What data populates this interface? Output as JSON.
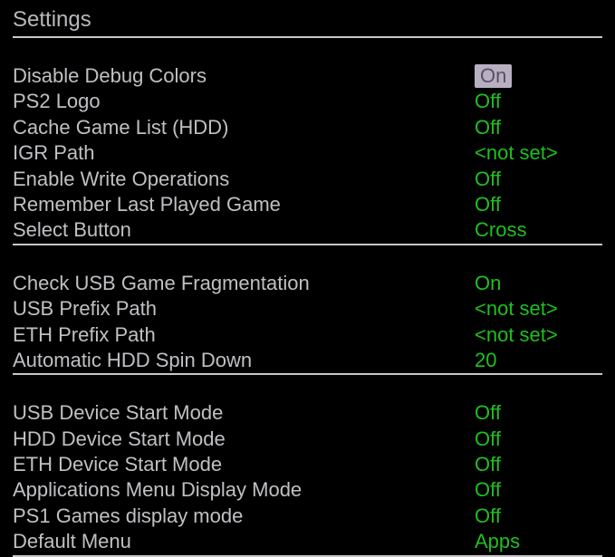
{
  "title": "Settings",
  "sections": [
    {
      "rows": [
        {
          "label": "Disable Debug Colors",
          "value": "On",
          "selected": true
        },
        {
          "label": "PS2 Logo",
          "value": "Off"
        },
        {
          "label": "Cache Game List (HDD)",
          "value": "Off"
        },
        {
          "label": "IGR Path",
          "value": "<not set>"
        },
        {
          "label": "Enable Write Operations",
          "value": "Off"
        },
        {
          "label": "Remember Last Played Game",
          "value": "Off"
        },
        {
          "label": "Select Button",
          "value": "Cross"
        }
      ]
    },
    {
      "rows": [
        {
          "label": "Check USB Game Fragmentation",
          "value": "On"
        },
        {
          "label": "USB Prefix Path",
          "value": "<not set>"
        },
        {
          "label": "ETH Prefix Path",
          "value": "<not set>"
        },
        {
          "label": "Automatic HDD Spin Down",
          "value": "20"
        }
      ]
    },
    {
      "rows": [
        {
          "label": "USB Device Start Mode",
          "value": "Off"
        },
        {
          "label": "HDD Device Start Mode",
          "value": "Off"
        },
        {
          "label": "ETH Device Start Mode",
          "value": "Off"
        },
        {
          "label": "Applications Menu Display Mode",
          "value": "Off"
        },
        {
          "label": "PS1 Games display mode",
          "value": "Off"
        },
        {
          "label": "Default Menu",
          "value": "Apps"
        }
      ]
    }
  ]
}
